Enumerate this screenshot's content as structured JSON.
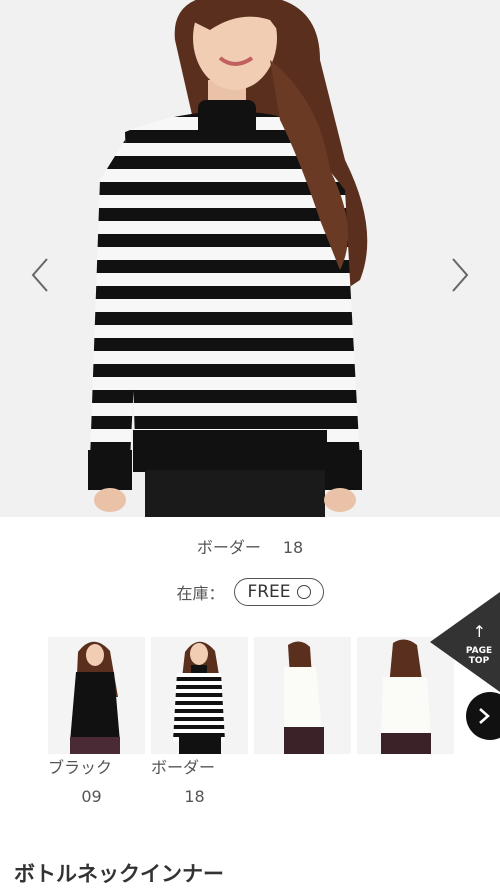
{
  "product": {
    "title": "ボトルネックインナー",
    "current_color": "ボーダー",
    "current_color_code": "18",
    "stock_label": "在庫：",
    "size": "FREE",
    "size_status_icon": "circle-available"
  },
  "gallery": {
    "prev_icon": "chevron-left-icon",
    "next_icon": "chevron-right-icon"
  },
  "variants": [
    {
      "name": "ブラック",
      "code": "09"
    },
    {
      "name": "ボーダー",
      "code": "18"
    },
    {
      "name": "",
      "code": ""
    },
    {
      "name": "",
      "code": ""
    }
  ],
  "page_top": {
    "line1": "PAGE",
    "line2": "TOP"
  },
  "colors": {
    "stripe_dark": "#111111",
    "stripe_light": "#f7f7f7",
    "hair": "#5a2f1e",
    "page_top_bg": "#333333"
  }
}
